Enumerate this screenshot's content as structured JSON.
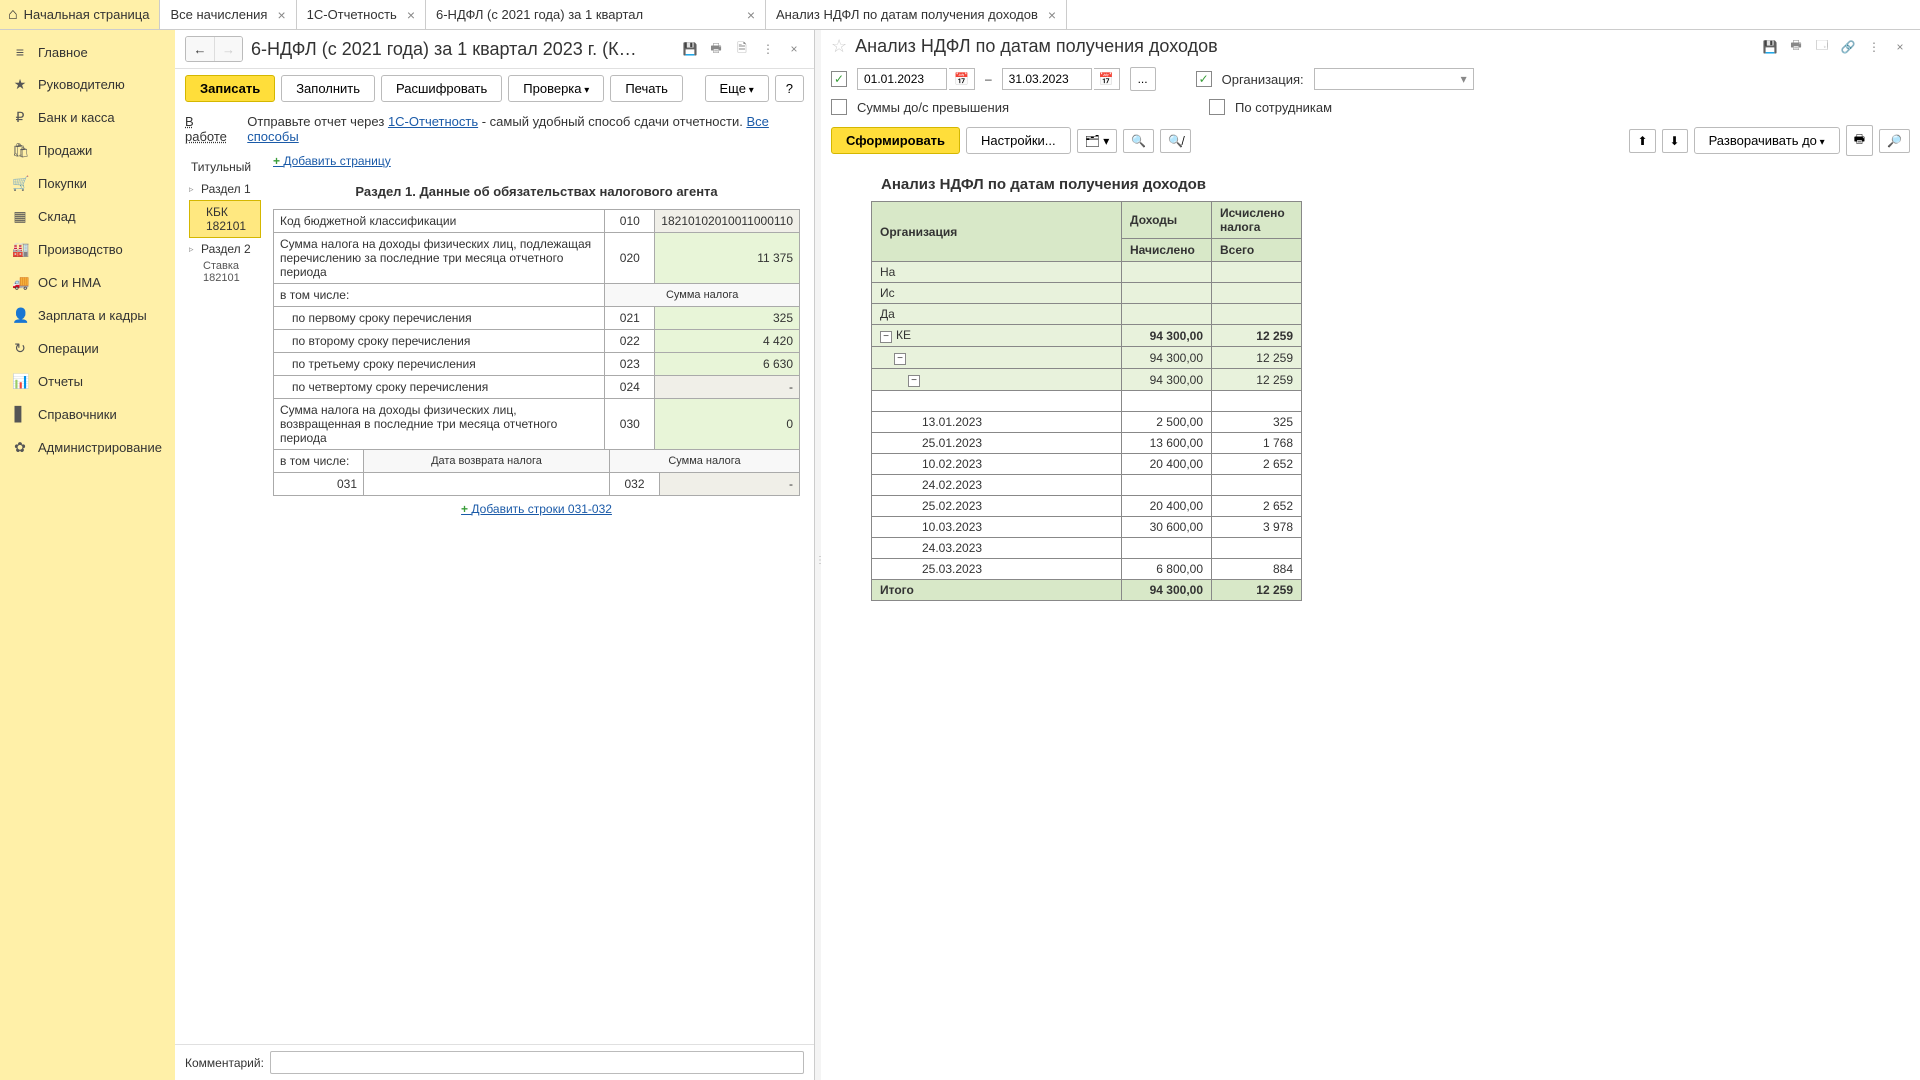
{
  "tabs": {
    "home": "Начальная страница",
    "t1": "Все начисления",
    "t2": "1С-Отчетность",
    "t3": "6-НДФЛ (с 2021 года) за 1 квартал",
    "t4": "Анализ НДФЛ по датам получения доходов"
  },
  "sidebar": [
    {
      "icon": "≡",
      "label": "Главное"
    },
    {
      "icon": "★",
      "label": "Руководителю"
    },
    {
      "icon": "₽",
      "label": "Банк и касса"
    },
    {
      "icon": "🛍",
      "label": "Продажи"
    },
    {
      "icon": "🛒",
      "label": "Покупки"
    },
    {
      "icon": "▦",
      "label": "Склад"
    },
    {
      "icon": "🏭",
      "label": "Производство"
    },
    {
      "icon": "🚚",
      "label": "ОС и НМА"
    },
    {
      "icon": "👤",
      "label": "Зарплата и кадры"
    },
    {
      "icon": "↻",
      "label": "Операции"
    },
    {
      "icon": "📊",
      "label": "Отчеты"
    },
    {
      "icon": "▋",
      "label": "Справочники"
    },
    {
      "icon": "✿",
      "label": "Администрирование"
    }
  ],
  "center": {
    "title": "6-НДФЛ (с 2021 года) за 1 квартал 2023 г. (К…",
    "buttons": {
      "save": "Записать",
      "fill": "Заполнить",
      "decode": "Расшифровать",
      "check": "Проверка",
      "print": "Печать",
      "more": "Еще",
      "help": "?"
    },
    "status": "В работе",
    "info_pre": "Отправьте отчет через ",
    "info_link1": "1С-Отчетность",
    "info_mid": " - самый удобный способ сдачи отчетности. ",
    "info_link2": "Все способы",
    "nav": {
      "title_page": "Титульный",
      "section1": "Раздел 1",
      "kbk_label": "КБК",
      "kbk_val": "182101",
      "section2": "Раздел 2",
      "rate_label": "Ставка",
      "rate_val": "182101"
    },
    "add_page": "Добавить страницу",
    "section_title": "Раздел 1. Данные об обязательствах налогового агента",
    "rows": {
      "r010_label": "Код бюджетной классификации",
      "r010_code": "010",
      "r010_val": "18210102010011000110",
      "r020_label": "Сумма налога на доходы физических лиц, подлежащая перечислению за последние три месяца отчетного периода",
      "r020_code": "020",
      "r020_val": "11 375",
      "incl": "в том числе:",
      "sum_hdr": "Сумма налога",
      "r021_label": "по первому сроку перечисления",
      "r021_code": "021",
      "r021_val": "325",
      "r022_label": "по второму сроку перечисления",
      "r022_code": "022",
      "r022_val": "4 420",
      "r023_label": "по третьему сроку перечисления",
      "r023_code": "023",
      "r023_val": "6 630",
      "r024_label": "по четвертому сроку перечисления",
      "r024_code": "024",
      "r024_val": "-",
      "r030_label": "Сумма налога на доходы физических лиц, возвращенная в последние три месяца отчетного периода",
      "r030_code": "030",
      "r030_val": "0",
      "date_hdr": "Дата возврата налога",
      "r031_code": "031",
      "r032_code": "032",
      "r032_val": "-"
    },
    "add_rows": "Добавить строки 031-032",
    "comment_label": "Комментарий:",
    "comment_value": ""
  },
  "right": {
    "title": "Анализ НДФЛ по датам получения доходов",
    "date_from": "01.01.2023",
    "date_to": "31.03.2023",
    "dash": "–",
    "dots_btn": "...",
    "org_label": "Организация:",
    "sums_label": "Суммы до/с превышения",
    "by_emp_label": "По сотрудникам",
    "form_btn": "Сформировать",
    "settings_btn": "Настройки...",
    "expand_btn": "Разворачивать до",
    "report_title": "Анализ НДФЛ по датам получения доходов",
    "headers": {
      "org": "Организация",
      "income": "Доходы",
      "tax": "Исчислено налога",
      "accrued": "Начислено",
      "total": "Всего"
    },
    "stub_rows": [
      "На",
      "Ис",
      "Да",
      "КЕ"
    ],
    "group_income": "94 300,00",
    "group_tax": "12 259",
    "sub1_income": "94 300,00",
    "sub1_tax": "12 259",
    "sub2_income": "94 300,00",
    "sub2_tax": "12 259",
    "details": [
      {
        "date": "13.01.2023",
        "income": "2 500,00",
        "tax": "325"
      },
      {
        "date": "25.01.2023",
        "income": "13 600,00",
        "tax": "1 768"
      },
      {
        "date": "10.02.2023",
        "income": "20 400,00",
        "tax": "2 652"
      },
      {
        "date": "24.02.2023",
        "income": "",
        "tax": ""
      },
      {
        "date": "25.02.2023",
        "income": "20 400,00",
        "tax": "2 652"
      },
      {
        "date": "10.03.2023",
        "income": "30 600,00",
        "tax": "3 978"
      },
      {
        "date": "24.03.2023",
        "income": "",
        "tax": ""
      },
      {
        "date": "25.03.2023",
        "income": "6 800,00",
        "tax": "884"
      }
    ],
    "total_label": "Итого",
    "total_income": "94 300,00",
    "total_tax": "12 259"
  }
}
